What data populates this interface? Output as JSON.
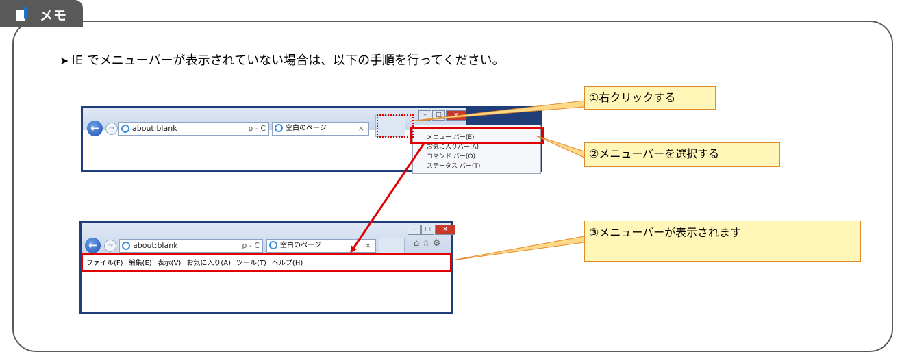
{
  "memo": {
    "label": "メモ"
  },
  "instruction": {
    "text": "IE でメニューバーが表示されていない場合は、以下の手順を行ってください。"
  },
  "browser_top": {
    "address": "about:blank",
    "address_tools": "ρ - C",
    "tab_title": "空白のページ",
    "tab_close": "×"
  },
  "context_menu": {
    "items": [
      "メニュー バー(E)",
      "お気に入りバー(A)",
      "コマンド バー(O)",
      "ステータス バー(T)"
    ]
  },
  "browser_bottom": {
    "address": "about:blank",
    "address_tools": "ρ - C",
    "tab_title": "空白のページ",
    "tab_close": "×",
    "menu_items": [
      "ファイル(F)",
      "編集(E)",
      "表示(V)",
      "お気に入り(A)",
      "ツール(T)",
      "ヘルプ(H)"
    ]
  },
  "callouts": {
    "step1": "①右クリックする",
    "step2": "②メニューバーを選択する",
    "step3": "③メニューバーが表示されます"
  },
  "colors": {
    "accent_red": "#e00000",
    "callout_bg": "#fff6b8",
    "callout_border": "#e08a2a",
    "memo_tab": "#595959"
  }
}
